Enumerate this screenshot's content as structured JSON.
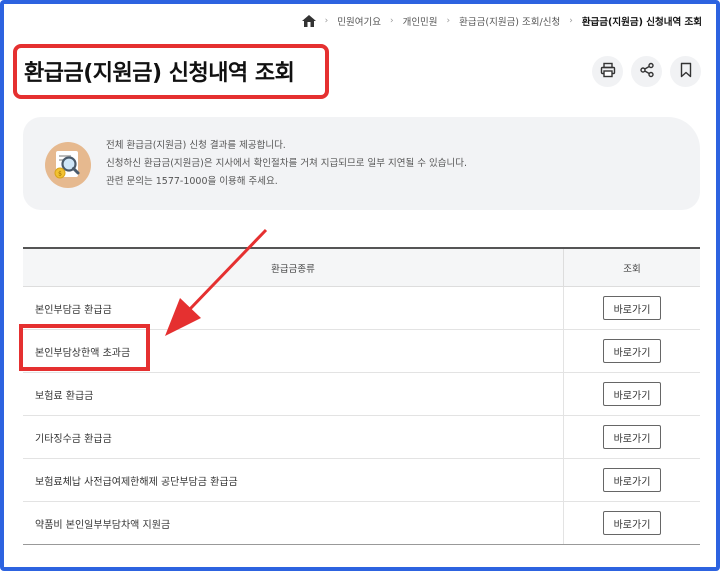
{
  "breadcrumb": {
    "items": [
      "민원여기요",
      "개인민원",
      "환급금(지원금) 조회/신청"
    ],
    "current": "환급금(지원금) 신청내역 조회"
  },
  "page": {
    "title": "환급금(지원금) 신청내역 조회"
  },
  "actions": {
    "icons": [
      "print-icon",
      "share-icon",
      "bookmark-icon"
    ]
  },
  "info": {
    "lines": [
      "전체 환급금(지원금) 신청 결과를 제공합니다.",
      "신청하신 환급금(지원금)은 지사에서 확인절차를 거쳐 지급되므로 일부 지연될 수 있습니다.",
      "관련 문의는 1577-1000을 이용해 주세요."
    ]
  },
  "table": {
    "headers": [
      "환급금종류",
      "조회"
    ],
    "rows": [
      {
        "type": "본인부담금 환급금",
        "action": "바로가기"
      },
      {
        "type": "본인부담상한액 초과금",
        "action": "바로가기"
      },
      {
        "type": "보험료 환급금",
        "action": "바로가기"
      },
      {
        "type": "기타징수금 환급금",
        "action": "바로가기"
      },
      {
        "type": "보험료체납 사전급여제한해제 공단부담금 환급금",
        "action": "바로가기"
      },
      {
        "type": "약품비 본인일부부담차액 지원금",
        "action": "바로가기"
      }
    ]
  },
  "colors": {
    "frame": "#2d63e0",
    "annotation": "#e53030"
  }
}
